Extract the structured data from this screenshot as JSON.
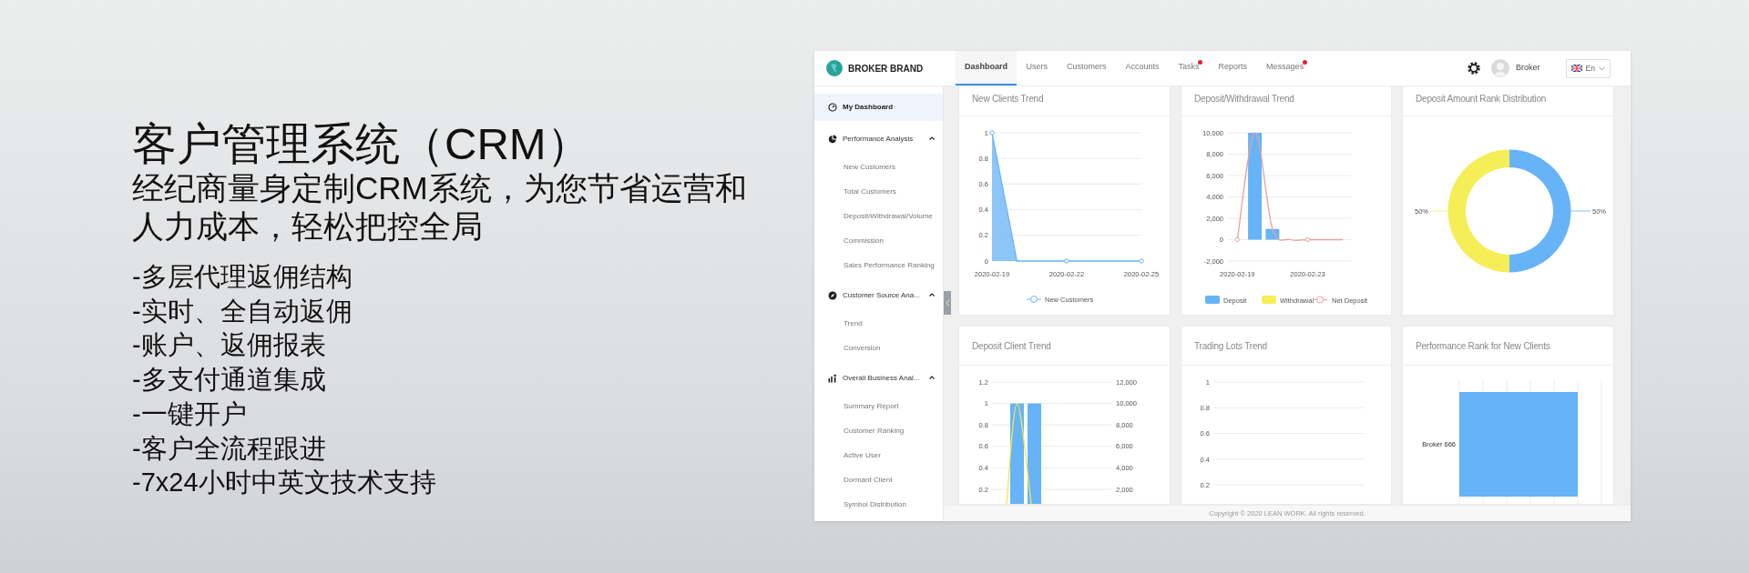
{
  "promo": {
    "title": "客户管理系统（CRM）",
    "subtitle": "经纪商量身定制CRM系统，为您节省运营和人力成本，轻松把控全局",
    "features": [
      "-多层代理返佣结构",
      "-实时、全自动返佣",
      "-账户、返佣报表",
      "-多支付通道集成",
      "-一键开户",
      "-客户全流程跟进",
      "-7x24小时中英文技术支持"
    ]
  },
  "app": {
    "brand": "BROKER BRAND",
    "nav": [
      {
        "label": "Dashboard",
        "selected": true,
        "alert": false
      },
      {
        "label": "Users",
        "selected": false,
        "alert": false
      },
      {
        "label": "Customers",
        "selected": false,
        "alert": false
      },
      {
        "label": "Accounts",
        "selected": false,
        "alert": false
      },
      {
        "label": "Tasks",
        "selected": false,
        "alert": true
      },
      {
        "label": "Reports",
        "selected": false,
        "alert": false
      },
      {
        "label": "Messages",
        "selected": false,
        "alert": true
      }
    ],
    "user": "Broker",
    "language": "En",
    "sidebar": [
      {
        "label": "My Dashboard",
        "selected": true
      },
      {
        "label": "Performance Analysis",
        "expanded": true,
        "children": [
          {
            "label": "New Customers",
            "selected": false
          },
          {
            "label": "Total Customers",
            "selected": false
          },
          {
            "label": "Deposit/Withdrawal/Volume",
            "selected": false
          },
          {
            "label": "Commission",
            "selected": false
          },
          {
            "label": "Sales Performance Ranking",
            "selected": false
          }
        ]
      },
      {
        "label": "Customer Source Ana...",
        "expanded": true,
        "children": [
          {
            "label": "Trend",
            "selected": false
          },
          {
            "label": "Conversion",
            "selected": false
          }
        ]
      },
      {
        "label": "Overall Business Anal...",
        "expanded": true,
        "children": [
          {
            "label": "Summary Report",
            "selected": false
          },
          {
            "label": "Customer Ranking",
            "selected": false
          },
          {
            "label": "Active User",
            "selected": false
          },
          {
            "label": "Dormant Client",
            "selected": false
          },
          {
            "label": "Symbol Distribution",
            "selected": false
          }
        ]
      }
    ],
    "cards": [
      {
        "title": "New Clients Trend",
        "chart_data": {
          "type": "area",
          "categories": [
            "2020-02-19",
            null,
            null,
            "2020-02-22",
            null,
            null,
            "2020-02-25"
          ],
          "grid": true,
          "ylim": [
            0,
            1
          ],
          "yticks": [
            0,
            0.2,
            0.4,
            0.6,
            0.8,
            1
          ],
          "series": [
            {
              "name": "New Customers",
              "color": "#66b3f7",
              "values": [
                1,
                0,
                0,
                0,
                0,
                0,
                0
              ]
            }
          ]
        }
      },
      {
        "title": "Deposit/Withdrawal Trend",
        "legend": [
          {
            "label": "Deposit",
            "kind": "swatch",
            "color": "#66b3f7"
          },
          {
            "label": "Withdrawal",
            "kind": "swatch",
            "color": "#f5ee57"
          },
          {
            "label": "Net Deposit",
            "kind": "line",
            "color": "#e9a0a0"
          }
        ],
        "chart_data": {
          "type": "bar",
          "categories": [
            "2020-02-19",
            null,
            null,
            null,
            "2020-02-23",
            null,
            null
          ],
          "grid": true,
          "ylim": [
            -2000,
            10000
          ],
          "yticks": [
            {
              "value": -2000,
              "label": "-2,000"
            },
            0,
            {
              "value": 2000,
              "label": "2,000"
            },
            {
              "value": 4000,
              "label": "4,000"
            },
            {
              "value": 6000,
              "label": "6,000"
            },
            {
              "value": 8000,
              "label": "8,000"
            },
            {
              "value": 10000,
              "label": "10,000"
            }
          ],
          "series": [
            {
              "type": "bar",
              "color": "#66b3f7",
              "values": [
                0,
                10000,
                1000,
                0,
                0,
                0,
                0
              ]
            },
            {
              "type": "line",
              "color": "#e9a0a0",
              "values": [
                0,
                10000,
                1000,
                0,
                0,
                0,
                0
              ]
            }
          ]
        }
      },
      {
        "title": "Deposit Amount Rank Distribution",
        "chart_data": {
          "type": "donut",
          "values": [
            50,
            50
          ],
          "colors": [
            "#66b3f7",
            "#f5ee57"
          ],
          "value_labels": [
            "50%",
            "50%"
          ]
        }
      },
      {
        "title": "Deposit Client Trend",
        "kind": "dual",
        "left_labels": [
          "1.2",
          "1",
          "0.8",
          "0.6",
          "0.4",
          "0.2"
        ],
        "right_labels": [
          "12,000",
          "10,000",
          "8,000",
          "6,000",
          "4,000",
          "2,000"
        ]
      },
      {
        "title": "Trading Lots Trend",
        "kind": "empty",
        "labels": [
          "1",
          "0.8",
          "0.6",
          "0.4",
          "0.2"
        ]
      },
      {
        "title": "Performance Rank for New Clients",
        "kind": "hbar",
        "labels": [
          "Broker 666"
        ]
      }
    ],
    "footer": "Copyright © 2020 LEAN WORK.  All rights reserved."
  }
}
